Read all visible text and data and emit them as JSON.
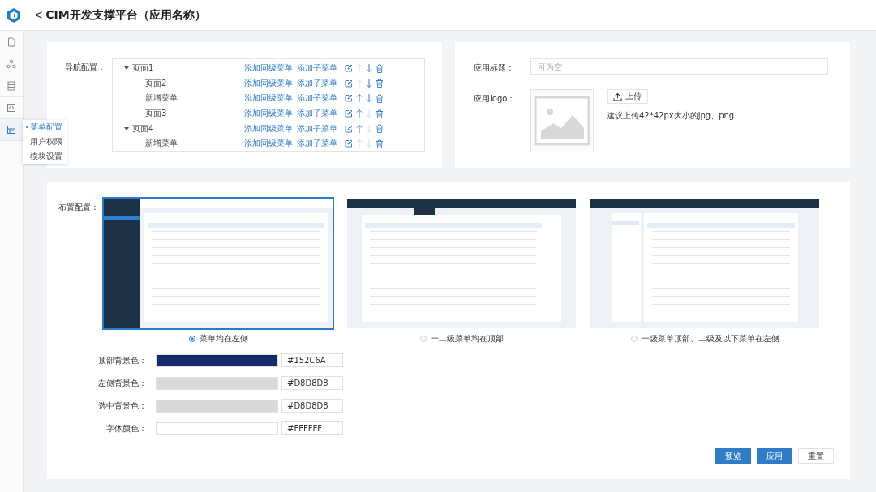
{
  "header": {
    "back_icon": "<",
    "title": "CIM开发支撑平台（应用名称）"
  },
  "sidebar": {
    "items": [
      {
        "selected": false
      },
      {
        "selected": false
      },
      {
        "selected": false
      },
      {
        "selected": false
      },
      {
        "selected": true
      }
    ]
  },
  "popup_menu": {
    "items": [
      {
        "label": "菜单配置",
        "selected": true
      },
      {
        "label": "用户权限",
        "selected": false
      },
      {
        "label": "模块设置",
        "selected": false
      }
    ]
  },
  "nav_config": {
    "label": "导航配置：",
    "tree": [
      {
        "label": "页面1",
        "expanded": true,
        "actions": [
          "添加同级菜单",
          "添加子菜单"
        ],
        "up_disabled": true,
        "down_disabled": false,
        "children": [
          {
            "label": "页面2",
            "actions": [
              "添加同级菜单",
              "添加子菜单"
            ],
            "up_disabled": true,
            "down_disabled": false
          },
          {
            "label": "新增菜单",
            "actions": [
              "添加同级菜单",
              "添加子菜单"
            ],
            "up_disabled": false,
            "down_disabled": false
          },
          {
            "label": "页面3",
            "actions": [
              "添加同级菜单",
              "添加子菜单"
            ],
            "up_disabled": false,
            "down_disabled": true
          }
        ]
      },
      {
        "label": "页面4",
        "expanded": true,
        "actions": [
          "添加同级菜单",
          "添加子菜单"
        ],
        "up_disabled": false,
        "down_disabled": true,
        "children": [
          {
            "label": "新增菜单",
            "actions": [
              "添加同级菜单",
              "添加子菜单"
            ],
            "up_disabled": true,
            "down_disabled": true
          }
        ]
      }
    ]
  },
  "app_settings": {
    "title_label": "应用标题：",
    "title_field": {
      "placeholder": "可为空"
    },
    "logo_label": "应用logo：",
    "upload_button": "上传",
    "upload_hint": "建议上传42*42px大小的jpg、png"
  },
  "layout_config": {
    "label": "布置配置：",
    "options": [
      {
        "kind": "left",
        "label": "菜单均在左侧",
        "selected": true
      },
      {
        "kind": "top",
        "label": "一二级菜单均在顶部",
        "selected": false
      },
      {
        "kind": "top-left",
        "label": "一级菜单顶部、二级及以下菜单在左侧",
        "selected": false
      }
    ],
    "colors": [
      {
        "label": "顶部背景色：",
        "value": "#152C6A",
        "color": "#152c6a"
      },
      {
        "label": "左侧背景色：",
        "value": "#D8D8D8",
        "color": "#d8d8d8"
      },
      {
        "label": "选中背景色：",
        "value": "#D8D8D8",
        "color": "#d8d8d8"
      },
      {
        "label": "字体颜色：",
        "value": "#FFFFFF",
        "color": "#ffffff"
      }
    ]
  },
  "buttons": [
    {
      "label": "预览",
      "kind": "primary"
    },
    {
      "label": "应用",
      "kind": "primary"
    },
    {
      "label": "重置",
      "kind": "default"
    }
  ]
}
